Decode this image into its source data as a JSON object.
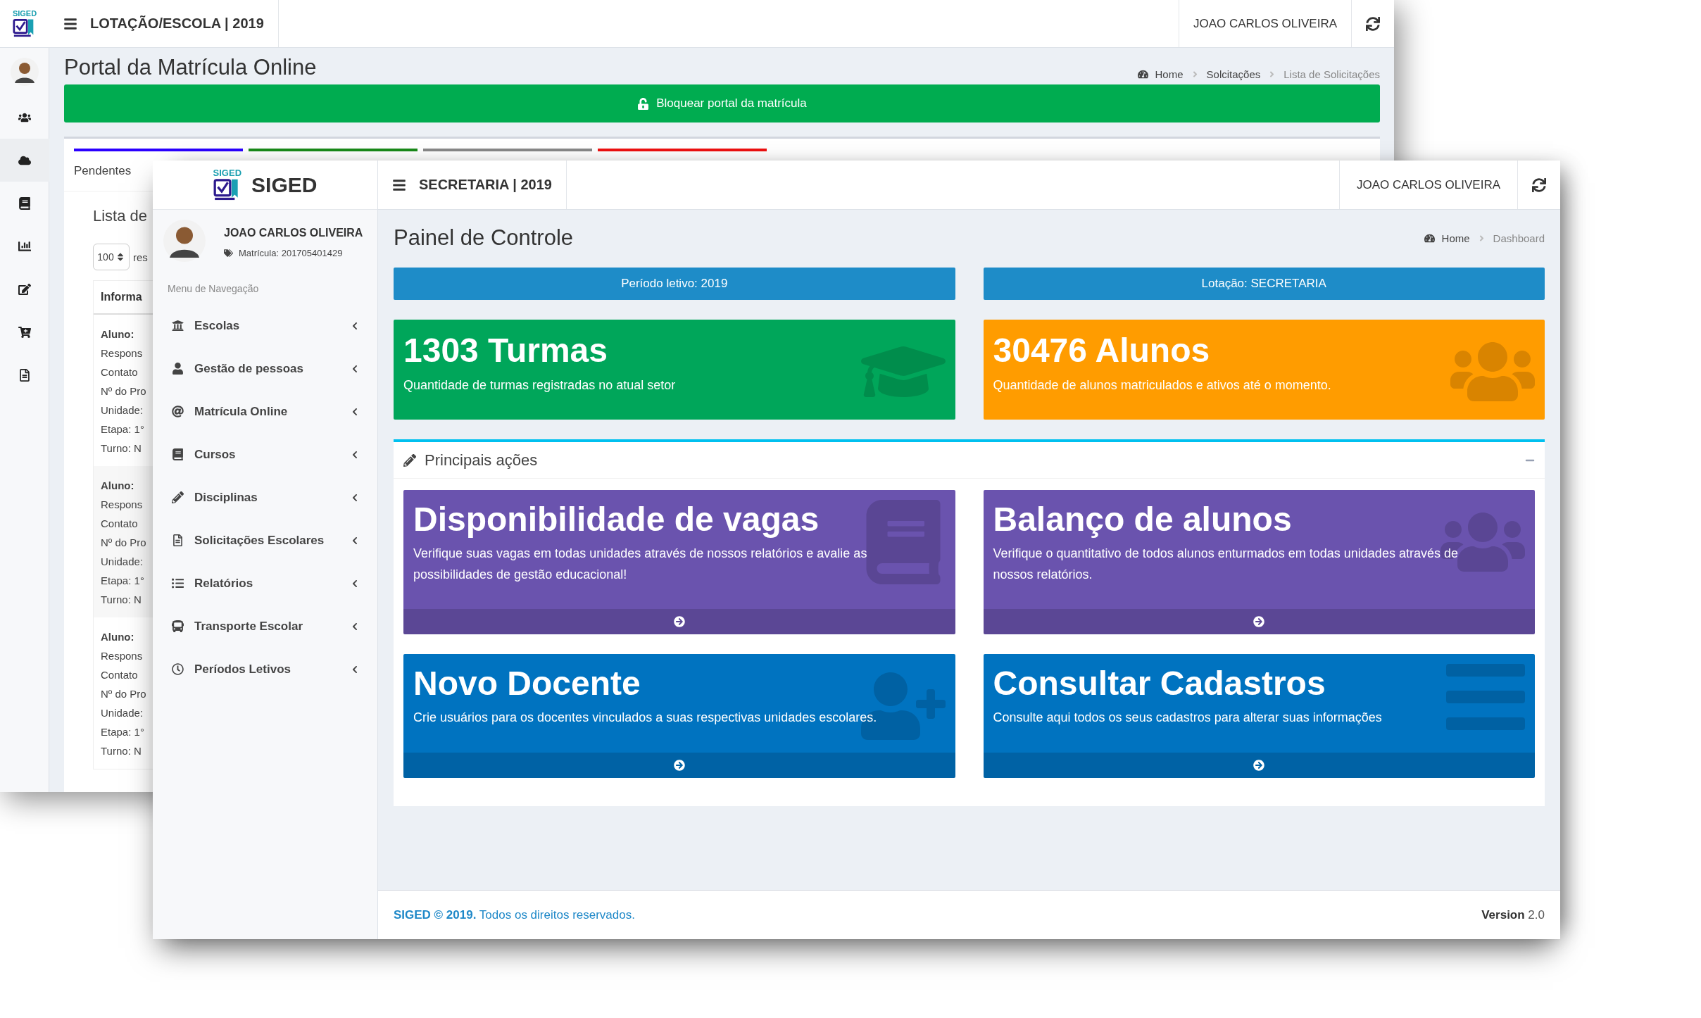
{
  "back_window": {
    "logo_text": "SIGED",
    "title": "LOTAÇÃO/ESCOLA | 2019",
    "user": "JOAO CARLOS OLIVEIRA",
    "sidebar_icons": [
      {
        "kind": "users",
        "selected": false
      },
      {
        "kind": "cloud",
        "selected": true
      },
      {
        "kind": "book",
        "selected": false
      },
      {
        "kind": "chart",
        "selected": false
      },
      {
        "kind": "edit",
        "selected": false
      },
      {
        "kind": "cart",
        "selected": false
      },
      {
        "kind": "file",
        "selected": false
      }
    ],
    "page_title": "Portal da Matrícula Online",
    "breadcrumb": [
      "Home",
      "Solcitações",
      "Lista de Solicitações"
    ],
    "lock_button": "Bloquear portal da matrícula",
    "tabs": [
      {
        "label": "Pendentes",
        "color": "#2b00ff"
      },
      {
        "color": "#1a8a1a"
      },
      {
        "color": "#888888"
      },
      {
        "color": "#ee1111"
      }
    ],
    "list_title": "Lista de",
    "page_size": "100",
    "page_size_suffix": "res",
    "table_header": "Informa",
    "records": [
      {
        "lines": [
          "Aluno:",
          "Respons",
          "Contato",
          "Nº do Pro",
          "Unidade:",
          "Etapa: 1°",
          "Turno: N"
        ]
      },
      {
        "lines": [
          "Aluno:",
          "Respons",
          "Contato",
          "Nº do Pro",
          "Unidade:",
          "Etapa: 1°",
          "Turno: N"
        ]
      },
      {
        "lines": [
          "Aluno:",
          "Respons",
          "Contato",
          "Nº do Pro",
          "Unidade:",
          "Etapa: 1°",
          "Turno: N"
        ]
      }
    ]
  },
  "front_window": {
    "logo_text": "SIGED",
    "brand": "SIGED",
    "title": "SECRETARIA | 2019",
    "user": "JOAO CARLOS OLIVEIRA",
    "profile": {
      "name": "JOAO CARLOS OLIVEIRA",
      "id": "Matrícula: 201705401429"
    },
    "menu_heading": "Menu de Navegação",
    "sidebar_items": [
      {
        "label": "Escolas",
        "kind": "school"
      },
      {
        "label": "Gestão de pessoas",
        "kind": "user"
      },
      {
        "label": "Matrícula Online",
        "kind": "at"
      },
      {
        "label": "Cursos",
        "kind": "book"
      },
      {
        "label": "Disciplinas",
        "kind": "pencil"
      },
      {
        "label": "Solicitações Escolares",
        "kind": "file"
      },
      {
        "label": "Relatórios",
        "kind": "list"
      },
      {
        "label": "Transporte Escolar",
        "kind": "bus"
      },
      {
        "label": "Períodos Letivos",
        "kind": "clock"
      }
    ],
    "page_title": "Painel de Controle",
    "breadcrumb": [
      "Home",
      "Dashboard"
    ],
    "info_bars": [
      "Período letivo: 2019",
      "Lotação: SECRETARIA"
    ],
    "stats": [
      {
        "title": "1303 Turmas",
        "text": "Quantidade de turmas registradas no atual setor",
        "kind": "graduation",
        "color": "#00a65a"
      },
      {
        "title": "30476 Alunos",
        "text": "Quantidade de alunos matriculados e ativos até o momento.",
        "kind": "users",
        "color": "#ff9c00"
      }
    ],
    "actions_title": "Principais ações",
    "actions": [
      {
        "title": "Disponibilidade de vagas",
        "text": "Verifique suas vagas em todas unidades através de nossos relatórios e avalie as possibilidades de gestão educacional!",
        "kind": "book",
        "color": "#6a53ae"
      },
      {
        "title": "Balanço de alunos",
        "text": "Verifique o quantitativo de todos alunos enturmados em todas unidades através de nossos relatórios.",
        "kind": "users",
        "color": "#6a53ae"
      },
      {
        "title": "Novo Docente",
        "text": "Crie usuários para os docentes vinculados a suas respectivas unidades escolares.",
        "kind": "user-plus",
        "color": "#0073c0"
      },
      {
        "title": "Consultar Cadastros",
        "text": "Consulte aqui todos os seus cadastros para alterar suas informações",
        "kind": "bars",
        "color": "#0073c0"
      }
    ],
    "footer": "**SIGED © 2019.** Todos os direitos reservados.",
    "version": "**Version** 2.0"
  }
}
